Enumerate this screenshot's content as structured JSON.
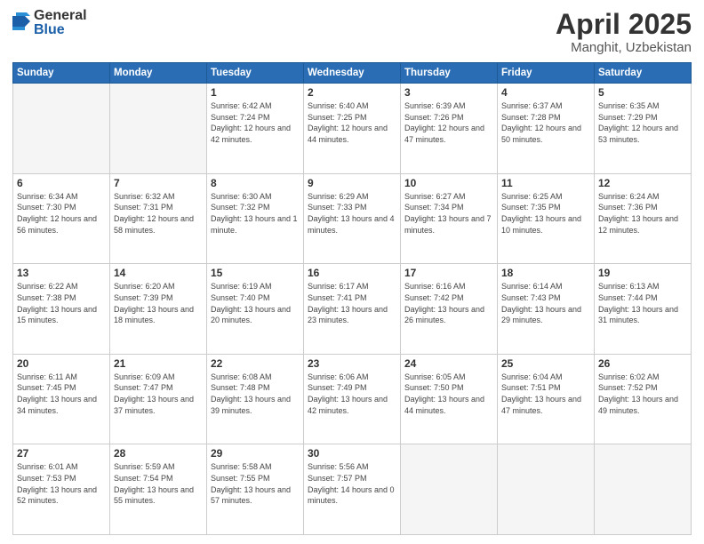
{
  "header": {
    "logo_general": "General",
    "logo_blue": "Blue",
    "title": "April 2025",
    "location": "Manghit, Uzbekistan"
  },
  "weekdays": [
    "Sunday",
    "Monday",
    "Tuesday",
    "Wednesday",
    "Thursday",
    "Friday",
    "Saturday"
  ],
  "weeks": [
    [
      {
        "day": "",
        "sunrise": "",
        "sunset": "",
        "daylight": ""
      },
      {
        "day": "",
        "sunrise": "",
        "sunset": "",
        "daylight": ""
      },
      {
        "day": "1",
        "sunrise": "Sunrise: 6:42 AM",
        "sunset": "Sunset: 7:24 PM",
        "daylight": "Daylight: 12 hours and 42 minutes."
      },
      {
        "day": "2",
        "sunrise": "Sunrise: 6:40 AM",
        "sunset": "Sunset: 7:25 PM",
        "daylight": "Daylight: 12 hours and 44 minutes."
      },
      {
        "day": "3",
        "sunrise": "Sunrise: 6:39 AM",
        "sunset": "Sunset: 7:26 PM",
        "daylight": "Daylight: 12 hours and 47 minutes."
      },
      {
        "day": "4",
        "sunrise": "Sunrise: 6:37 AM",
        "sunset": "Sunset: 7:28 PM",
        "daylight": "Daylight: 12 hours and 50 minutes."
      },
      {
        "day": "5",
        "sunrise": "Sunrise: 6:35 AM",
        "sunset": "Sunset: 7:29 PM",
        "daylight": "Daylight: 12 hours and 53 minutes."
      }
    ],
    [
      {
        "day": "6",
        "sunrise": "Sunrise: 6:34 AM",
        "sunset": "Sunset: 7:30 PM",
        "daylight": "Daylight: 12 hours and 56 minutes."
      },
      {
        "day": "7",
        "sunrise": "Sunrise: 6:32 AM",
        "sunset": "Sunset: 7:31 PM",
        "daylight": "Daylight: 12 hours and 58 minutes."
      },
      {
        "day": "8",
        "sunrise": "Sunrise: 6:30 AM",
        "sunset": "Sunset: 7:32 PM",
        "daylight": "Daylight: 13 hours and 1 minute."
      },
      {
        "day": "9",
        "sunrise": "Sunrise: 6:29 AM",
        "sunset": "Sunset: 7:33 PM",
        "daylight": "Daylight: 13 hours and 4 minutes."
      },
      {
        "day": "10",
        "sunrise": "Sunrise: 6:27 AM",
        "sunset": "Sunset: 7:34 PM",
        "daylight": "Daylight: 13 hours and 7 minutes."
      },
      {
        "day": "11",
        "sunrise": "Sunrise: 6:25 AM",
        "sunset": "Sunset: 7:35 PM",
        "daylight": "Daylight: 13 hours and 10 minutes."
      },
      {
        "day": "12",
        "sunrise": "Sunrise: 6:24 AM",
        "sunset": "Sunset: 7:36 PM",
        "daylight": "Daylight: 13 hours and 12 minutes."
      }
    ],
    [
      {
        "day": "13",
        "sunrise": "Sunrise: 6:22 AM",
        "sunset": "Sunset: 7:38 PM",
        "daylight": "Daylight: 13 hours and 15 minutes."
      },
      {
        "day": "14",
        "sunrise": "Sunrise: 6:20 AM",
        "sunset": "Sunset: 7:39 PM",
        "daylight": "Daylight: 13 hours and 18 minutes."
      },
      {
        "day": "15",
        "sunrise": "Sunrise: 6:19 AM",
        "sunset": "Sunset: 7:40 PM",
        "daylight": "Daylight: 13 hours and 20 minutes."
      },
      {
        "day": "16",
        "sunrise": "Sunrise: 6:17 AM",
        "sunset": "Sunset: 7:41 PM",
        "daylight": "Daylight: 13 hours and 23 minutes."
      },
      {
        "day": "17",
        "sunrise": "Sunrise: 6:16 AM",
        "sunset": "Sunset: 7:42 PM",
        "daylight": "Daylight: 13 hours and 26 minutes."
      },
      {
        "day": "18",
        "sunrise": "Sunrise: 6:14 AM",
        "sunset": "Sunset: 7:43 PM",
        "daylight": "Daylight: 13 hours and 29 minutes."
      },
      {
        "day": "19",
        "sunrise": "Sunrise: 6:13 AM",
        "sunset": "Sunset: 7:44 PM",
        "daylight": "Daylight: 13 hours and 31 minutes."
      }
    ],
    [
      {
        "day": "20",
        "sunrise": "Sunrise: 6:11 AM",
        "sunset": "Sunset: 7:45 PM",
        "daylight": "Daylight: 13 hours and 34 minutes."
      },
      {
        "day": "21",
        "sunrise": "Sunrise: 6:09 AM",
        "sunset": "Sunset: 7:47 PM",
        "daylight": "Daylight: 13 hours and 37 minutes."
      },
      {
        "day": "22",
        "sunrise": "Sunrise: 6:08 AM",
        "sunset": "Sunset: 7:48 PM",
        "daylight": "Daylight: 13 hours and 39 minutes."
      },
      {
        "day": "23",
        "sunrise": "Sunrise: 6:06 AM",
        "sunset": "Sunset: 7:49 PM",
        "daylight": "Daylight: 13 hours and 42 minutes."
      },
      {
        "day": "24",
        "sunrise": "Sunrise: 6:05 AM",
        "sunset": "Sunset: 7:50 PM",
        "daylight": "Daylight: 13 hours and 44 minutes."
      },
      {
        "day": "25",
        "sunrise": "Sunrise: 6:04 AM",
        "sunset": "Sunset: 7:51 PM",
        "daylight": "Daylight: 13 hours and 47 minutes."
      },
      {
        "day": "26",
        "sunrise": "Sunrise: 6:02 AM",
        "sunset": "Sunset: 7:52 PM",
        "daylight": "Daylight: 13 hours and 49 minutes."
      }
    ],
    [
      {
        "day": "27",
        "sunrise": "Sunrise: 6:01 AM",
        "sunset": "Sunset: 7:53 PM",
        "daylight": "Daylight: 13 hours and 52 minutes."
      },
      {
        "day": "28",
        "sunrise": "Sunrise: 5:59 AM",
        "sunset": "Sunset: 7:54 PM",
        "daylight": "Daylight: 13 hours and 55 minutes."
      },
      {
        "day": "29",
        "sunrise": "Sunrise: 5:58 AM",
        "sunset": "Sunset: 7:55 PM",
        "daylight": "Daylight: 13 hours and 57 minutes."
      },
      {
        "day": "30",
        "sunrise": "Sunrise: 5:56 AM",
        "sunset": "Sunset: 7:57 PM",
        "daylight": "Daylight: 14 hours and 0 minutes."
      },
      {
        "day": "",
        "sunrise": "",
        "sunset": "",
        "daylight": ""
      },
      {
        "day": "",
        "sunrise": "",
        "sunset": "",
        "daylight": ""
      },
      {
        "day": "",
        "sunrise": "",
        "sunset": "",
        "daylight": ""
      }
    ]
  ]
}
